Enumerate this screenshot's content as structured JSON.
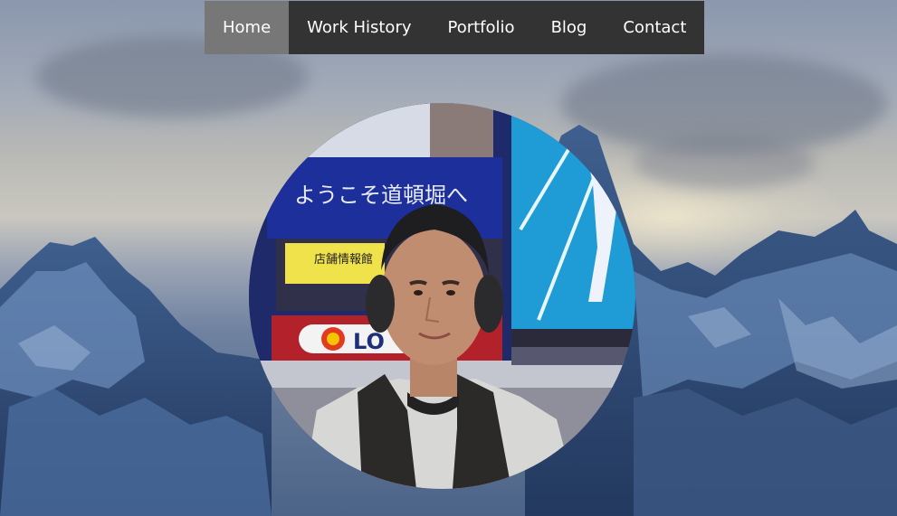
{
  "nav": {
    "items": [
      {
        "label": "Home",
        "active": true
      },
      {
        "label": "Work History",
        "active": false
      },
      {
        "label": "Portfolio",
        "active": false
      },
      {
        "label": "Blog",
        "active": false
      },
      {
        "label": "Contact",
        "active": false
      }
    ]
  },
  "hero": {
    "background_image": "snowy-mountains-photo",
    "profile_image": "profile-photo",
    "photo_signs": {
      "welcome": "ようこそ道頓堀へ",
      "info": "店舗情報館",
      "brand": "LO"
    }
  },
  "colors": {
    "nav_bg": "#333333",
    "nav_active_bg": "#777777",
    "nav_text": "#ffffff"
  }
}
